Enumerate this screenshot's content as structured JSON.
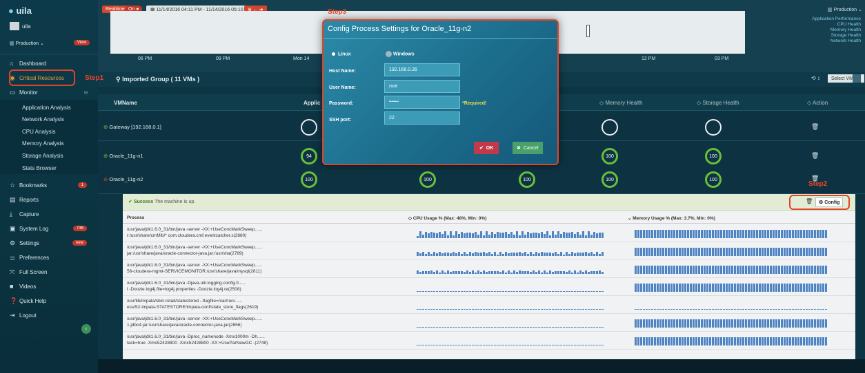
{
  "app": {
    "logo": "uila",
    "user": "uila",
    "env_selector": "Production",
    "view_badge": "View"
  },
  "sidebar": {
    "items": [
      {
        "label": "Dashboard",
        "icon": "home-icon"
      },
      {
        "label": "Critical Resources",
        "icon": "pin-icon"
      },
      {
        "label": "Monitor",
        "icon": "monitor-icon"
      }
    ],
    "monitor_sub": [
      "Application Analysis",
      "Network Analysis",
      "CPU Analysis",
      "Memory Analysis",
      "Storage Analysis",
      "Stats Browser"
    ],
    "items2": [
      {
        "label": "Bookmarks",
        "badge": "1"
      },
      {
        "label": "Reports"
      },
      {
        "label": "Capture"
      },
      {
        "label": "System Log",
        "badge": "738"
      },
      {
        "label": "Settings",
        "badge": "new"
      },
      {
        "label": "Preferences"
      },
      {
        "label": "Full Screen"
      },
      {
        "label": "Videos"
      },
      {
        "label": "Quick Help"
      },
      {
        "label": "Logout"
      }
    ]
  },
  "topbar": {
    "realtime": "Realtime",
    "on": "On",
    "daterange": "11/14/2016 04:11 PM - 11/14/2016 05:10 PM",
    "env_right": "Production",
    "health_links": [
      "Application Performance",
      "CPU Health",
      "Memory Health",
      "Storage Health",
      "Network Health"
    ],
    "ticks": [
      "06 PM",
      "09 PM",
      "Mon 14",
      "12 PM",
      "03 PM"
    ]
  },
  "group": {
    "title": "Imported Group  ( 11 VMs )",
    "select": "Select VMs"
  },
  "table": {
    "headers": [
      "VMName",
      "Applic",
      "Memory Health",
      "Storage Health",
      "Action"
    ],
    "rows": [
      {
        "name": "Gateway [192.168.0.1]",
        "vals": [
          "",
          "",
          "",
          ""
        ]
      },
      {
        "name": "Oracle_11g-n1",
        "vals": [
          "94",
          "",
          "100",
          "100"
        ]
      },
      {
        "name": "Oracle_11g-n2",
        "vals": [
          "100",
          "100",
          "100",
          "100",
          "100"
        ]
      }
    ]
  },
  "annotations": {
    "step1": "Step1",
    "step2": "Step2",
    "step3": "Step3"
  },
  "process_panel": {
    "status_bold": "Success",
    "status_text": "The machine is up.",
    "config_label": "Config",
    "col_process": "Process",
    "col_cpu": "CPU Usage %   (Max: 48%, Min: 0%)",
    "col_mem": "Memory Usage %   (Max: 3.7%, Min: 0%)",
    "rows": [
      {
        "l1": "/usr/java/jdk1.6.0_31/bin/java -server -XX:+UseConcMarkSweep......",
        "l2": "r:/usr/share/cmf/lib/* com.cloudera.cmf.eventcatcher.s(2880)",
        "cpu": 0.7,
        "mem": 1
      },
      {
        "l1": "/usr/java/jdk1.6.0_31/bin/java -server -XX:+UseConcMarkSweep......",
        "l2": "jar:/usr/share/java/oracle-connector-java.jar:/usr/sha(2789)",
        "cpu": 0.45,
        "mem": 1
      },
      {
        "l1": "/usr/java/jdk1.6.0_31/bin/java -server -XX:+UseConcMarkSweep......",
        "l2": "56-cloudera-mgmt-SERVICEMONITOR:/usr/share/java/mysql(2811)",
        "cpu": 0.35,
        "mem": 1
      },
      {
        "l1": "/usr/java/jdk1.6.0_31/bin/java -Djava.util.logging.config.fi......",
        "l2": "l -Doozie.log4j.file=log4j.properties -Doozie.log4j.re(2508)",
        "cpu": 0.05,
        "mem": 1
      },
      {
        "l1": "/usr/lib/impala/sbin-retail/statestored --flagfile=/var/run/......",
        "l2": "ess/52-impala-STATESTORE/impala-conf/state_store_flags(2619)",
        "cpu": 0.02,
        "mem": 0.05
      },
      {
        "l1": "/usr/java/jdk1.6.0_31/bin/java -server -XX:+UseConcMarkSweep......",
        "l2": "1.jdbc4.jar:/usr/share/java/oracle-connector-java.jar(2856)",
        "cpu": 0.02,
        "mem": 1
      },
      {
        "l1": "/usr/java/jdk1.6.0_31/bin/java -Dproc_namenode -Xmx1000m -Dh......",
        "l2": "tack=true -Xms52428800 -Xmx52428800 -XX:+UseParNewGC -(2748)",
        "cpu": 0.02,
        "mem": 1
      }
    ]
  },
  "modal": {
    "title": "Config Process Settings for Oracle_11g-n2",
    "os": [
      "Linux",
      "Windows"
    ],
    "host_label": "Host Name:",
    "host": "192.168.0.35",
    "user_label": "User Name:",
    "user": "root",
    "pass_label": "Password:",
    "pass": "••••••••",
    "required": "*Required!",
    "ssh_label": "SSH port:",
    "ssh": "22",
    "ok": "OK",
    "cancel": "Cancel"
  }
}
